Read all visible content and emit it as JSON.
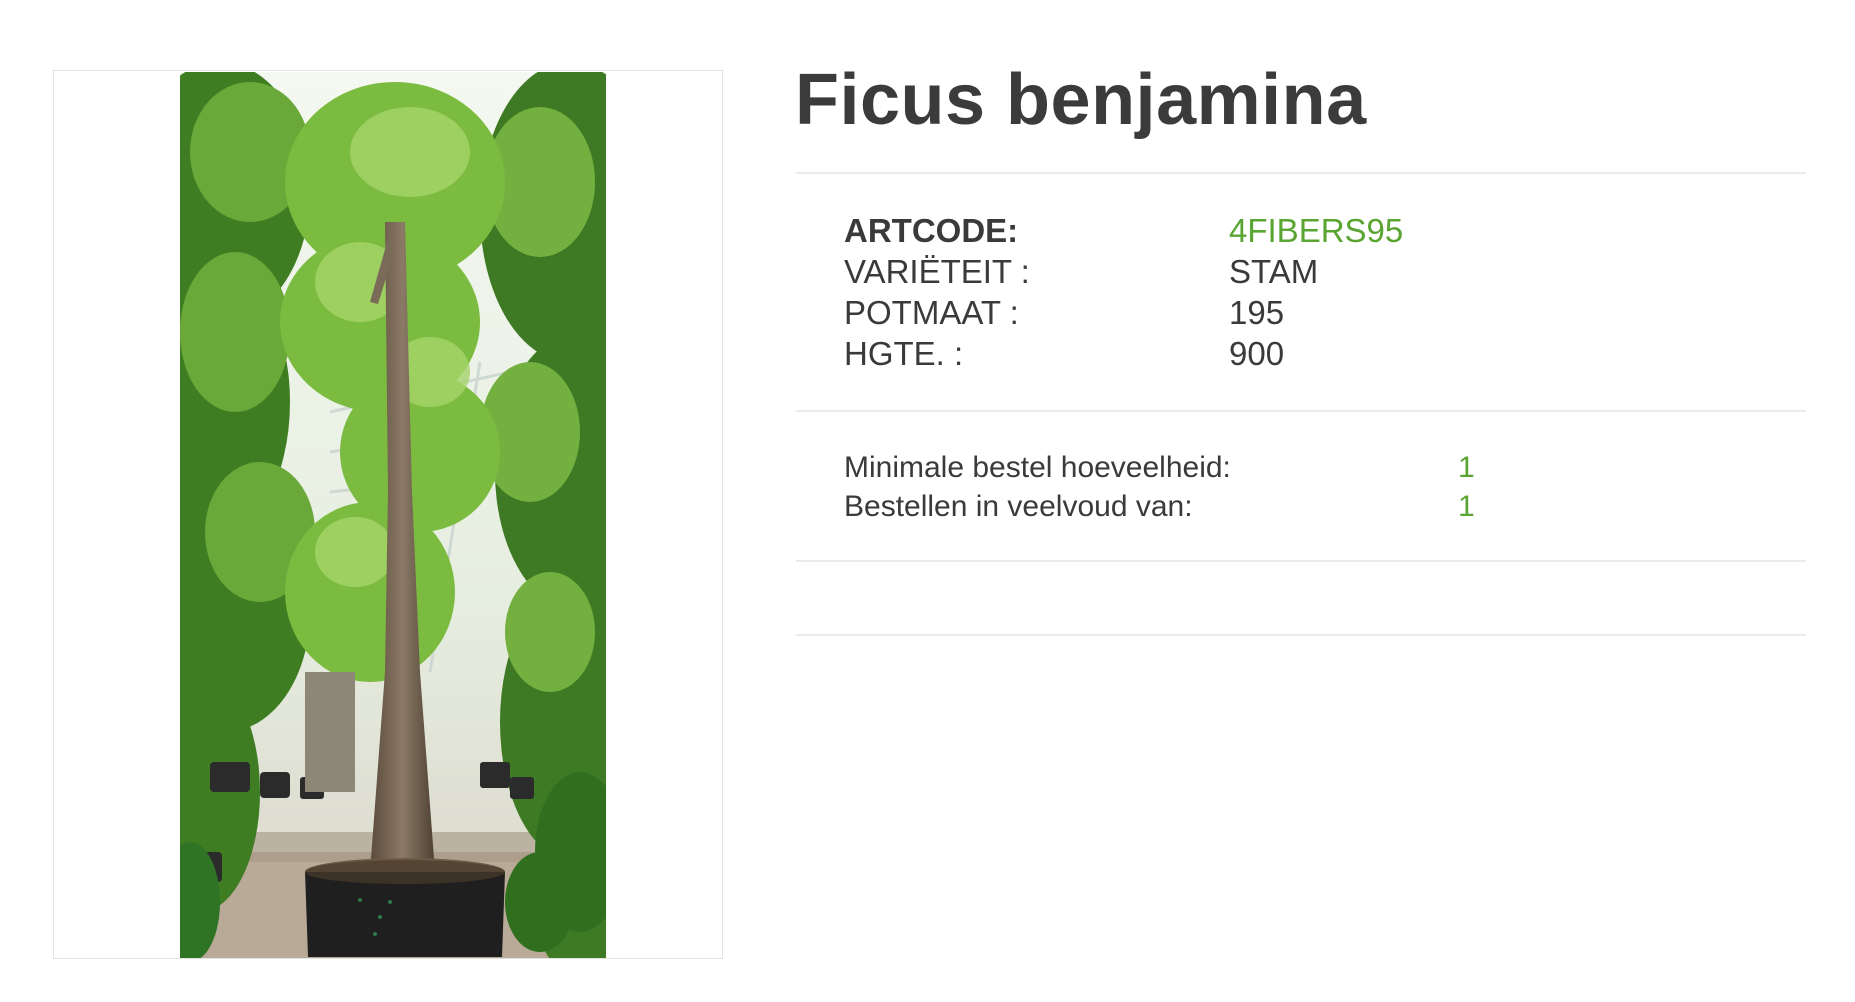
{
  "product": {
    "title": "Ficus benjamina",
    "image_subject": "ficus-tree-photo"
  },
  "specs": [
    {
      "label": "ARTCODE:",
      "value": "4FIBERS95",
      "label_bold": true,
      "value_color": "#5aa531"
    },
    {
      "label": "VARIËTEIT :",
      "value": "STAM"
    },
    {
      "label": "POTMAAT :",
      "value": "195"
    },
    {
      "label": "HGTE. :",
      "value": "900"
    }
  ],
  "order": [
    {
      "label": "Minimale bestel hoeveelheid:",
      "value": "1"
    },
    {
      "label": "Bestellen in veelvoud van:",
      "value": "1"
    }
  ],
  "colors": {
    "accent_green": "#5aa531",
    "text": "#3a3a3a",
    "divider": "#ebebeb"
  }
}
